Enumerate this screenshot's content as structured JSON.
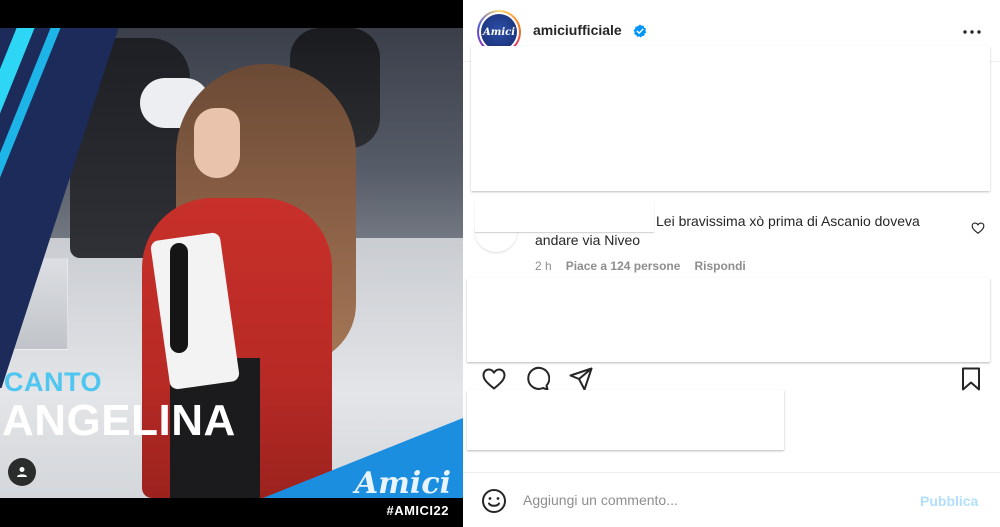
{
  "post": {
    "category_label": "CANTO",
    "name_label": "ANGELINA",
    "logo_text": "Amici",
    "hashtag": "#AMICI22"
  },
  "header": {
    "avatar_text": "Amici",
    "username": "amiciufficiale",
    "verified": true
  },
  "comment": {
    "text": "Lei bravissima xò prima di Ascanio doveva andare via Niveo",
    "time": "2 h",
    "likes": "Piace a 124 persone",
    "reply": "Rispondi"
  },
  "actions": {
    "icons": [
      "heart-icon",
      "comment-icon",
      "share-icon",
      "bookmark-icon"
    ]
  },
  "add_comment": {
    "placeholder": "Aggiungi un commento...",
    "publish_label": "Pubblica"
  },
  "colors": {
    "accent_blue": "#0095f6",
    "publish_disabled": "#b2dffc",
    "brand_cyan": "#4ec6f0",
    "hoodie_red": "#c8302a"
  }
}
